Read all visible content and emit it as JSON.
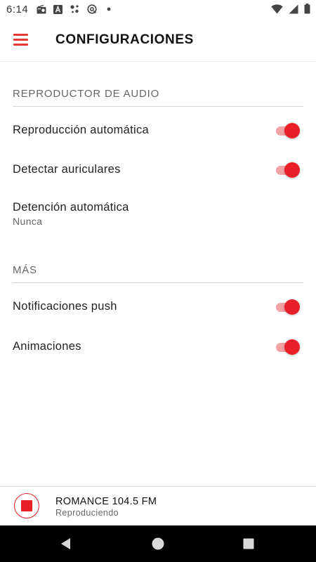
{
  "status_bar": {
    "time": "6:14",
    "left_icons": [
      "radio-icon",
      "a-box-icon",
      "assistant-dots-icon",
      "at-sign-icon",
      "dot-icon"
    ],
    "right_icons": [
      "wifi-icon",
      "signal-icon",
      "battery-icon"
    ]
  },
  "app_bar": {
    "title": "CONFIGURACIONES",
    "menu_icon": "hamburger-menu-icon"
  },
  "sections": {
    "audio": {
      "header": "REPRODUCTOR DE AUDIO",
      "autoplay": {
        "label": "Reproducción automática",
        "enabled": true
      },
      "headphones": {
        "label": "Detectar auriculares",
        "enabled": true
      },
      "autostop": {
        "label": "Detención automática",
        "value": "Nunca"
      }
    },
    "more": {
      "header": "MÁS",
      "push": {
        "label": "Notificaciones push",
        "enabled": true
      },
      "animations": {
        "label": "Animaciones",
        "enabled": true
      }
    }
  },
  "player": {
    "station": "ROMANCE 104.5 FM",
    "status": "Reproduciendo",
    "stop_icon": "stop-icon"
  },
  "nav_bar": {
    "icons": [
      "back-icon",
      "home-icon",
      "recents-icon"
    ]
  },
  "colors": {
    "accent": "#e8202a",
    "toggle_track": "#f4a1a5",
    "nav_background": "#000000"
  }
}
